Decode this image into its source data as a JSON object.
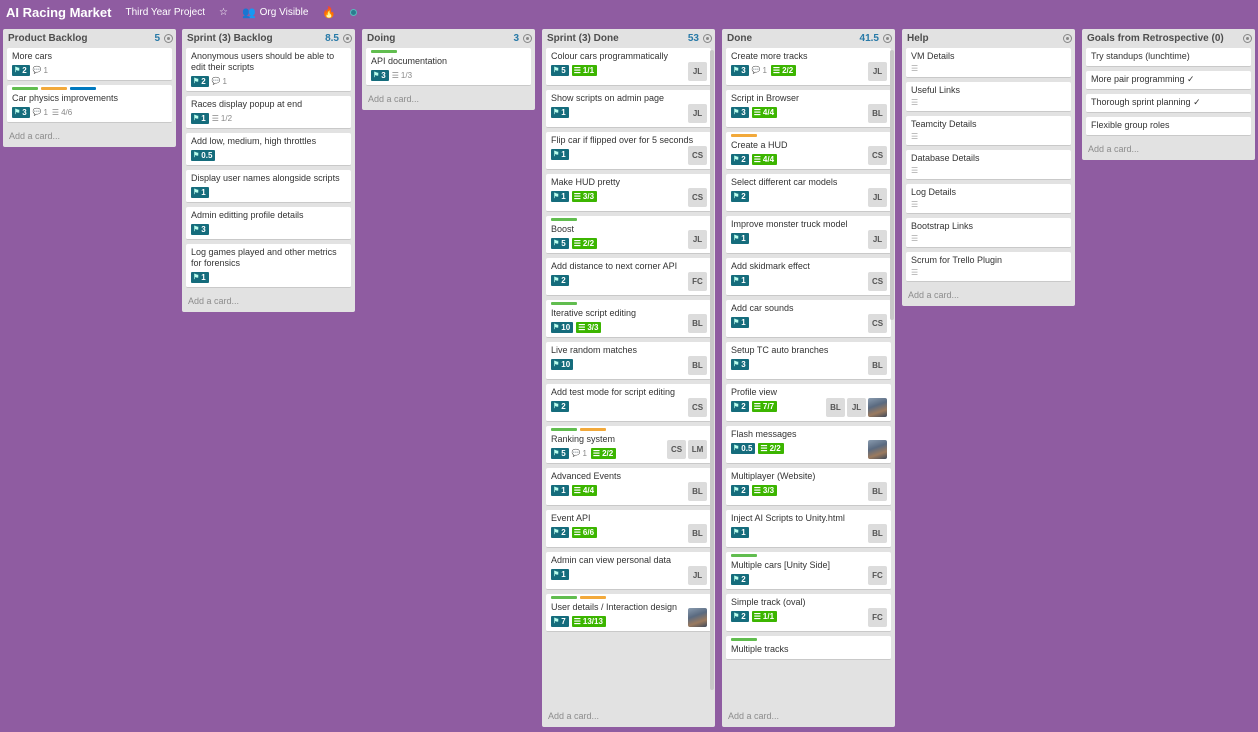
{
  "board": {
    "title": "AI Racing Market",
    "team": "Third Year Project",
    "visibility": "Org Visible",
    "star_icon": "star-icon",
    "visibility_icon": "people-icon",
    "activity_icon": "flame-icon"
  },
  "add_card_label": "Add a card...",
  "lists": [
    {
      "title": "Product Backlog",
      "points": "5",
      "cards": [
        {
          "title": "More cars",
          "labels": [],
          "points": "2",
          "comments": "1"
        },
        {
          "title": "Car physics improvements",
          "labels": [
            "#61bd4f",
            "#f2a93b",
            "#0079bf"
          ],
          "points": "3",
          "comments": "1",
          "checklist": "4/6"
        }
      ]
    },
    {
      "title": "Sprint (3) Backlog",
      "points": "8.5",
      "cards": [
        {
          "title": "Anonymous users should be able to edit their scripts",
          "points": "2",
          "comments": "1"
        },
        {
          "title": "Races display popup at end",
          "points": "1",
          "checklist": "1/2"
        },
        {
          "title": "Add low, medium, high throttles",
          "points": "0.5"
        },
        {
          "title": "Display user names alongside scripts",
          "points": "1"
        },
        {
          "title": "Admin editting profile details",
          "points": "3"
        },
        {
          "title": "Log games played and other metrics for forensics",
          "points": "1"
        }
      ]
    },
    {
      "title": "Doing",
      "points": "3",
      "cards": [
        {
          "title": "API documentation",
          "labels": [
            "#61bd4f"
          ],
          "points": "3",
          "checklist": "1/3"
        }
      ]
    },
    {
      "title": "Sprint (3) Done",
      "points": "53",
      "cards": [
        {
          "title": "Colour cars programmatically",
          "points": "5",
          "checklist_done": "1/1",
          "members": [
            "JL"
          ]
        },
        {
          "title": "Show scripts on admin page",
          "points": "1",
          "members": [
            "JL"
          ]
        },
        {
          "title": "Flip car if flipped over for 5 seconds",
          "points": "1",
          "members": [
            "CS"
          ]
        },
        {
          "title": "Make HUD pretty",
          "points": "1",
          "checklist_done": "3/3",
          "members": [
            "CS"
          ]
        },
        {
          "title": "Boost",
          "labels": [
            "#61bd4f"
          ],
          "points": "5",
          "checklist_done": "2/2",
          "members": [
            "JL"
          ]
        },
        {
          "title": "Add distance to next corner API",
          "points": "2",
          "members": [
            "FC"
          ]
        },
        {
          "title": "Iterative script editing",
          "labels": [
            "#61bd4f"
          ],
          "points": "10",
          "checklist_done": "3/3",
          "members": [
            "BL"
          ]
        },
        {
          "title": "Live random matches",
          "points": "10",
          "members": [
            "BL"
          ]
        },
        {
          "title": "Add test mode for script editing",
          "points": "2",
          "members": [
            "CS"
          ]
        },
        {
          "title": "Ranking system",
          "labels": [
            "#61bd4f",
            "#f2a93b"
          ],
          "points": "5",
          "comments": "1",
          "checklist_done": "2/2",
          "members": [
            "CS",
            "LM"
          ]
        },
        {
          "title": "Advanced Events",
          "points": "1",
          "checklist_done": "4/4",
          "members": [
            "BL"
          ]
        },
        {
          "title": "Event API",
          "points": "2",
          "checklist_done": "6/6",
          "members": [
            "BL"
          ]
        },
        {
          "title": "Admin can view personal data",
          "points": "1",
          "members": [
            "JL"
          ]
        },
        {
          "title": "User details / Interaction design",
          "labels": [
            "#61bd4f",
            "#f2a93b"
          ],
          "points": "7",
          "checklist_done": "13/13",
          "members": [
            "photo"
          ]
        }
      ]
    },
    {
      "title": "Done",
      "points": "41.5",
      "cards": [
        {
          "title": "Create more tracks",
          "points": "3",
          "comments": "1",
          "checklist_done": "2/2",
          "members": [
            "JL"
          ]
        },
        {
          "title": "Script in Browser",
          "points": "3",
          "checklist_done": "4/4",
          "members": [
            "BL"
          ]
        },
        {
          "title": "Create a HUD",
          "labels": [
            "#f2a93b"
          ],
          "points": "2",
          "checklist_done": "4/4",
          "members": [
            "CS"
          ]
        },
        {
          "title": "Select different car models",
          "points": "2",
          "members": [
            "JL"
          ]
        },
        {
          "title": "Improve monster truck model",
          "points": "1",
          "members": [
            "JL"
          ]
        },
        {
          "title": "Add skidmark effect",
          "points": "1",
          "members": [
            "CS"
          ]
        },
        {
          "title": "Add car sounds",
          "points": "1",
          "members": [
            "CS"
          ]
        },
        {
          "title": "Setup TC auto branches",
          "points": "3",
          "members": [
            "BL"
          ]
        },
        {
          "title": "Profile view",
          "points": "2",
          "checklist_done": "7/7",
          "members": [
            "BL",
            "JL",
            "photo"
          ]
        },
        {
          "title": "Flash messages",
          "points": "0.5",
          "checklist_done": "2/2",
          "members": [
            "photo"
          ]
        },
        {
          "title": "Multiplayer (Website)",
          "points": "2",
          "checklist_done": "3/3",
          "members": [
            "BL"
          ]
        },
        {
          "title": "Inject AI Scripts to Unity.html",
          "points": "1",
          "members": [
            "BL"
          ]
        },
        {
          "title": "Multiple cars [Unity Side]",
          "labels": [
            "#61bd4f"
          ],
          "points": "2",
          "members": [
            "FC"
          ]
        },
        {
          "title": "Simple track (oval)",
          "points": "2",
          "checklist_done": "1/1",
          "members": [
            "FC"
          ]
        },
        {
          "title": "Multiple tracks",
          "labels": [
            "#61bd4f"
          ]
        }
      ]
    },
    {
      "title": "Help",
      "points": "",
      "cards": [
        {
          "title": "VM Details",
          "desc": true
        },
        {
          "title": "Useful Links",
          "desc": true
        },
        {
          "title": "Teamcity Details",
          "desc": true
        },
        {
          "title": "Database Details",
          "desc": true
        },
        {
          "title": "Log Details",
          "desc": true
        },
        {
          "title": "Bootstrap Links",
          "desc": true
        },
        {
          "title": "Scrum for Trello Plugin",
          "desc": true
        }
      ]
    },
    {
      "title": "Goals from Retrospective (0)",
      "points": "",
      "cards": [
        {
          "title": "Try standups (lunchtime)"
        },
        {
          "title": "More pair programming ✓"
        },
        {
          "title": "Thorough sprint planning ✓"
        },
        {
          "title": "Flexible group roles"
        }
      ]
    }
  ]
}
